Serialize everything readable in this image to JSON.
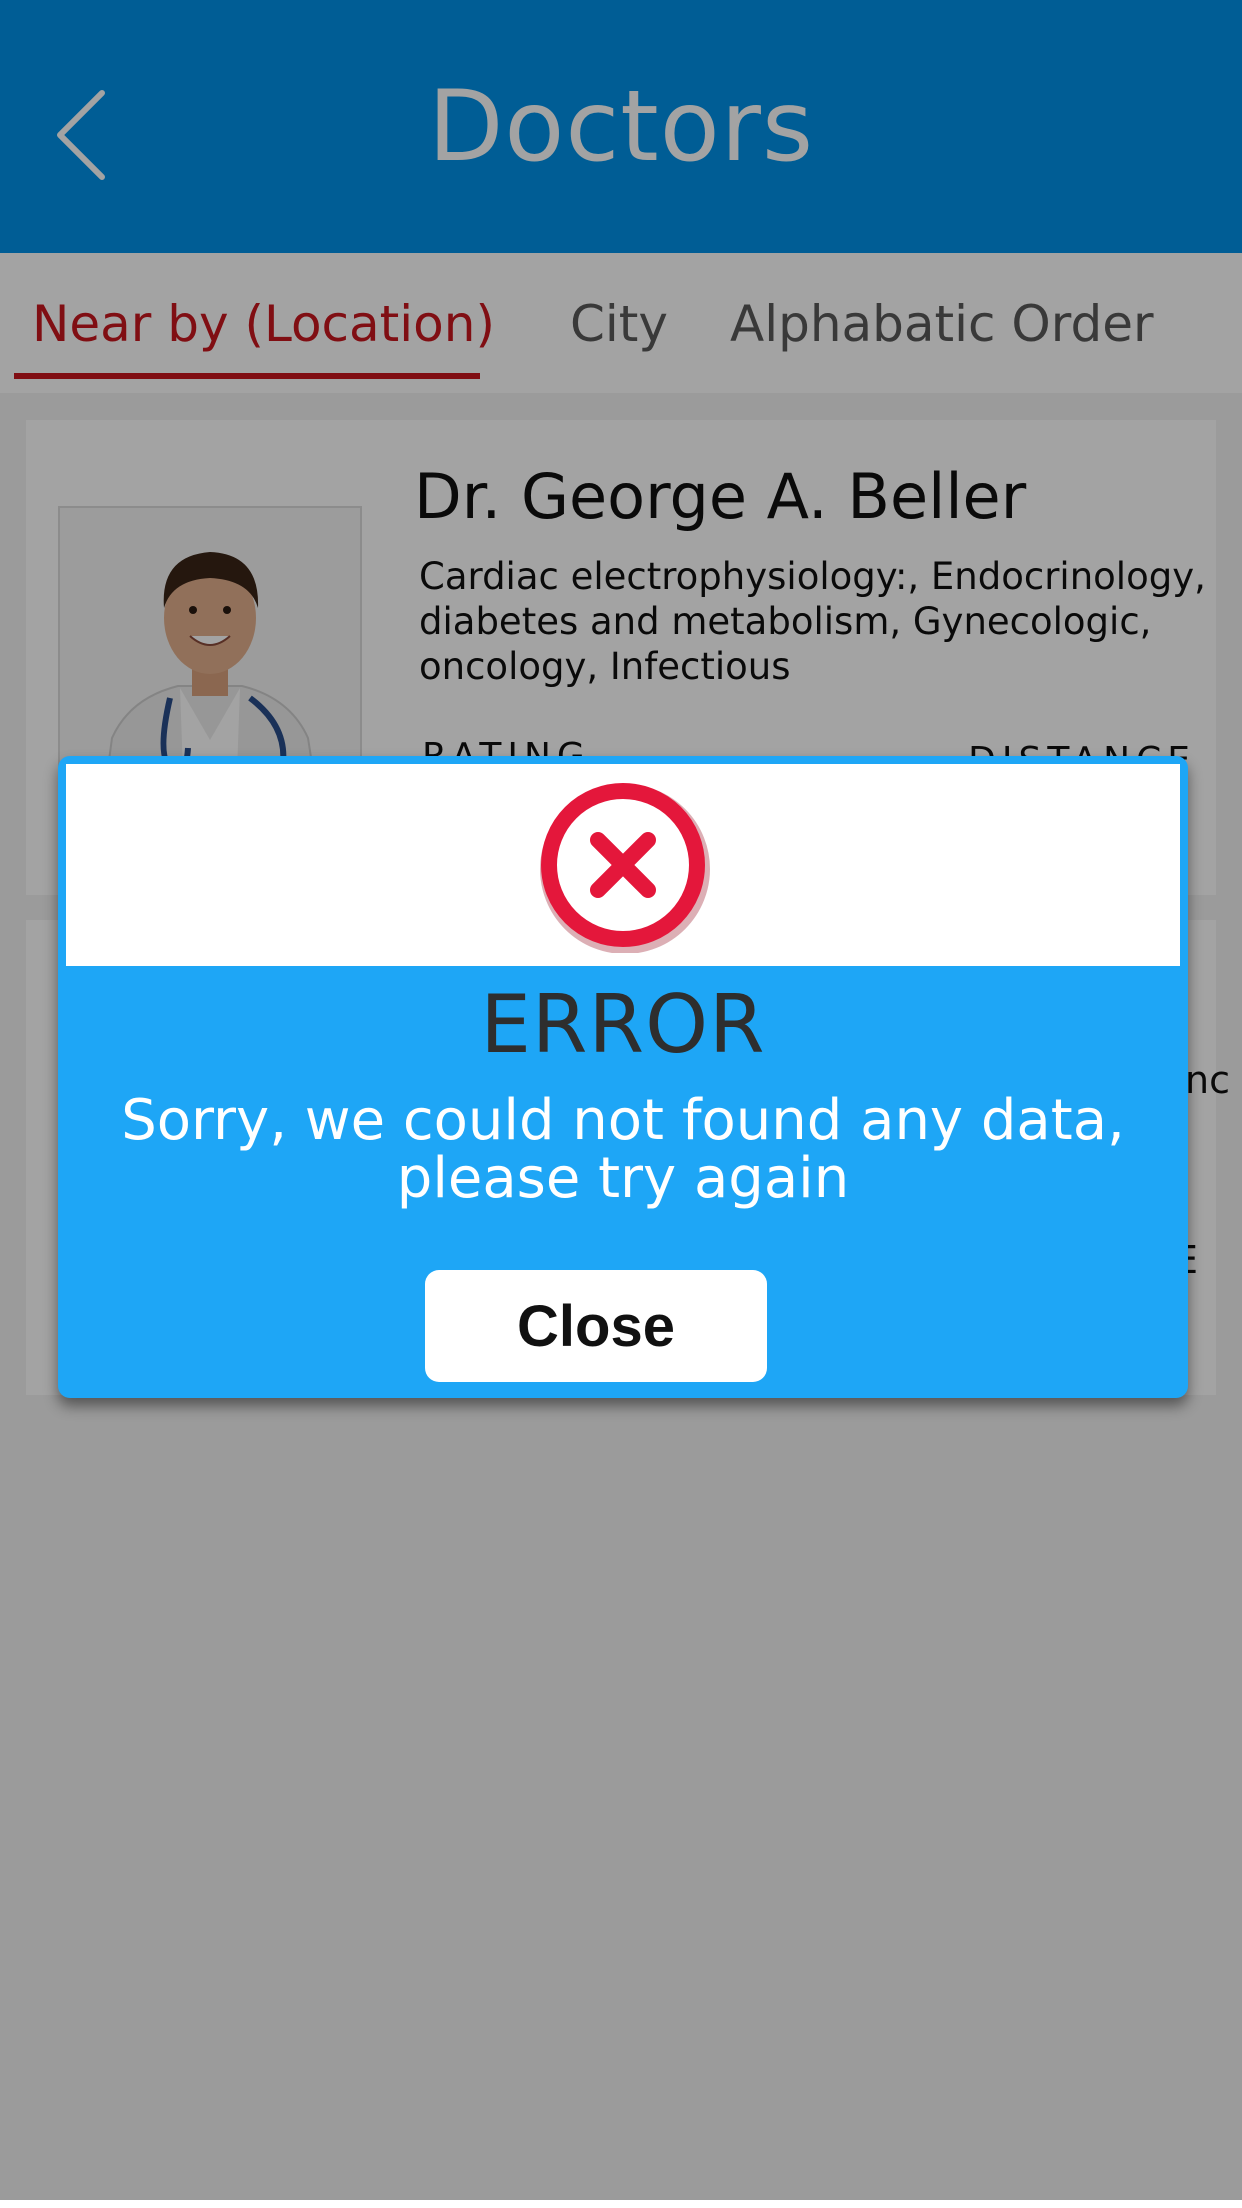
{
  "header": {
    "title": "Doctors",
    "back_icon": "chevron-left-icon"
  },
  "tabs": [
    {
      "label": "Near by (Location)",
      "active": true
    },
    {
      "label": "City",
      "active": false
    },
    {
      "label": "Alphabatic Order",
      "active": false
    }
  ],
  "doctors": [
    {
      "name": "Dr. George A. Beller",
      "specialties": "Cardiac electrophysiology:, Endocrinology, diabetes and metabolism, Gynecologic, oncology, Infectious",
      "rating_label": "RATING",
      "distance_label": "DISTANCE"
    },
    {
      "partial_specialty_fragment": "rinc",
      "partial_label_fragment": "E"
    }
  ],
  "dialog": {
    "icon": "error-x-icon",
    "title": "ERROR",
    "message_line1": "Sorry, we could not found any data,",
    "message_line2": "please try again",
    "close_label": "Close"
  },
  "colors": {
    "header": "#0092e9",
    "active_tab": "#c8171e",
    "dialog": "#1ea6f6",
    "error_red": "#e4173b"
  }
}
